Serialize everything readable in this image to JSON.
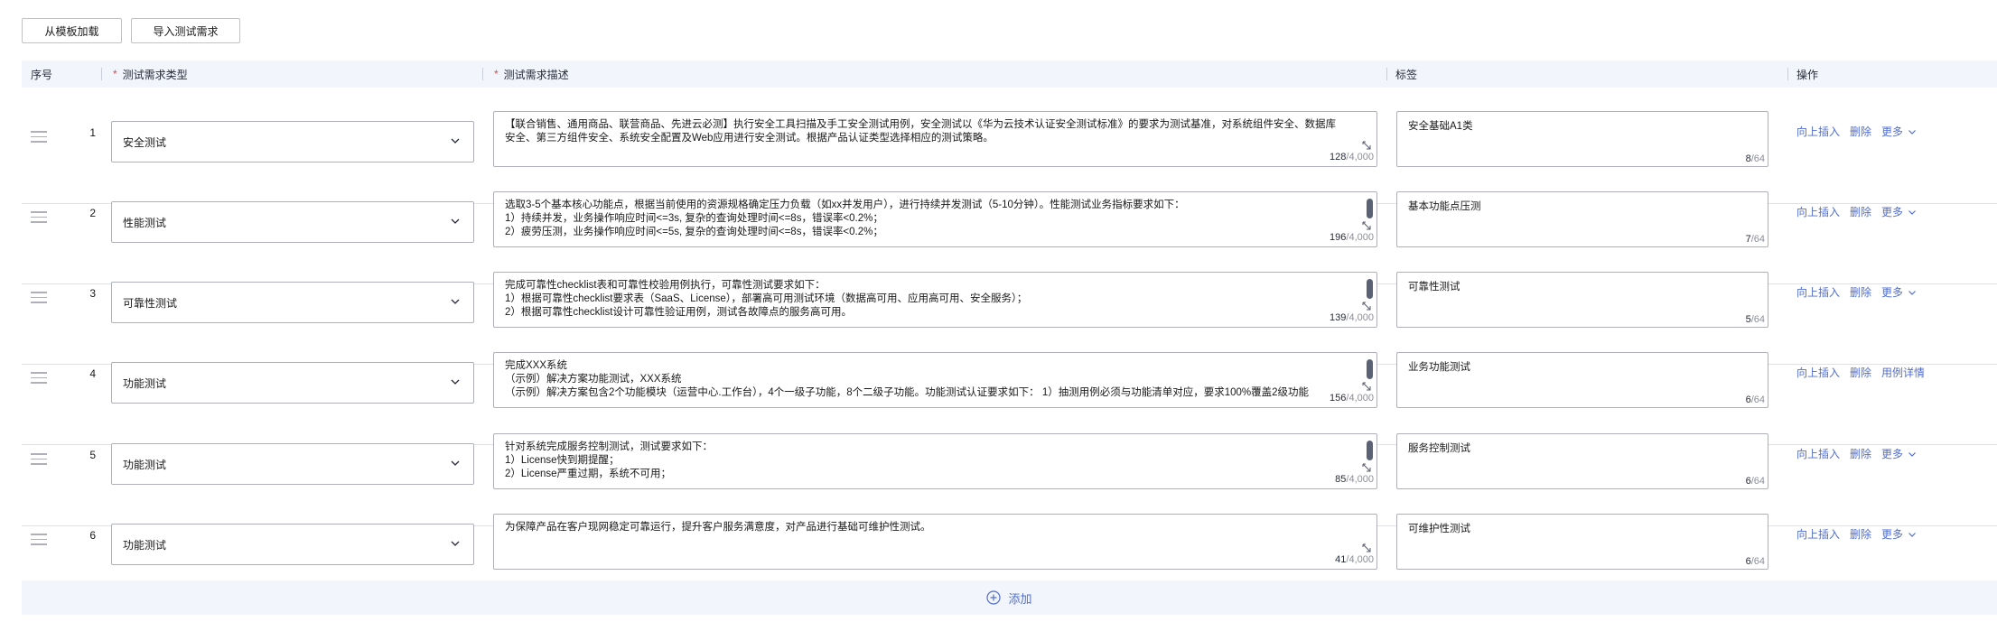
{
  "toolbar": {
    "load_template": "从模板加载",
    "import_requirements": "导入测试需求"
  },
  "table": {
    "headers": {
      "index": "序号",
      "type": "测试需求类型",
      "description": "测试需求描述",
      "tag": "标签",
      "actions": "操作"
    },
    "required_mark": "*"
  },
  "rows": [
    {
      "index": "1",
      "type": "安全测试",
      "description": "【联合销售、通用商品、联营商品、先进云必测】执行安全工具扫描及手工安全测试用例，安全测试以《华为云技术认证安全测试标准》的要求为测试基准，对系统组件安全、数据库安全、第三方组件安全、系统安全配置及Web应用进行安全测试。根据产品认证类型选择相应的测试策略。",
      "desc_count": "128",
      "desc_max": "/4,000",
      "tag": "安全基础A1类",
      "tag_count": "8",
      "tag_max": "/64",
      "ops": [
        "向上插入",
        "删除",
        "更多"
      ],
      "scrollbar": false
    },
    {
      "index": "2",
      "type": "性能测试",
      "description": "选取3-5个基本核心功能点，根据当前使用的资源规格确定压力负载（如xx并发用户），进行持续并发测试（5-10分钟）。性能测试业务指标要求如下：\n1）持续并发，业务操作响应时间<=3s, 复杂的查询处理时间<=8s，错误率<0.2%；\n2）疲劳压测，业务操作响应时间<=5s, 复杂的查询处理时间<=8s，错误率<0.2%；",
      "desc_count": "196",
      "desc_max": "/4,000",
      "tag": "基本功能点压测",
      "tag_count": "7",
      "tag_max": "/64",
      "ops": [
        "向上插入",
        "删除",
        "更多"
      ],
      "scrollbar": true
    },
    {
      "index": "3",
      "type": "可靠性测试",
      "description": "完成可靠性checklist表和可靠性校验用例执行，可靠性测试要求如下：\n1）根据可靠性checklist要求表（SaaS、License），部署高可用测试环境（数据高可用、应用高可用、安全服务）；\n2）根据可靠性checklist设计可靠性验证用例，测试各故障点的服务高可用。",
      "desc_count": "139",
      "desc_max": "/4,000",
      "tag": "可靠性测试",
      "tag_count": "5",
      "tag_max": "/64",
      "ops": [
        "向上插入",
        "删除",
        "更多"
      ],
      "scrollbar": true
    },
    {
      "index": "4",
      "type": "功能测试",
      "description": "完成XXX系统\n（示例）解决方案功能测试，XXX系统\n（示例）解决方案包含2个功能模块（运营中心.工作台），4个一级子功能，8个二级子功能。功能测试认证要求如下： 1）抽测用例必须与功能清单对应，要求100%覆盖2级功能",
      "desc_count": "156",
      "desc_max": "/4,000",
      "tag": "业务功能测试",
      "tag_count": "6",
      "tag_max": "/64",
      "ops": [
        "向上插入",
        "删除",
        "用例详情"
      ],
      "scrollbar": true
    },
    {
      "index": "5",
      "type": "功能测试",
      "description": "针对系统完成服务控制测试，测试要求如下：\n1）License快到期提醒；\n2）License严重过期，系统不可用；",
      "desc_count": "85",
      "desc_max": "/4,000",
      "tag": "服务控制测试",
      "tag_count": "6",
      "tag_max": "/64",
      "ops": [
        "向上插入",
        "删除",
        "更多"
      ],
      "scrollbar": true
    },
    {
      "index": "6",
      "type": "功能测试",
      "description": "为保障产品在客户现网稳定可靠运行，提升客户服务满意度，对产品进行基础可维护性测试。",
      "desc_count": "41",
      "desc_max": "/4,000",
      "tag": "可维护性测试",
      "tag_count": "6",
      "tag_max": "/64",
      "ops": [
        "向上插入",
        "删除",
        "更多"
      ],
      "scrollbar": false
    }
  ],
  "add_button": "添加",
  "colors": {
    "accent": "#526ecc",
    "required": "#e54545",
    "header_bg": "#f2f5fc",
    "border": "#adb0b8"
  }
}
